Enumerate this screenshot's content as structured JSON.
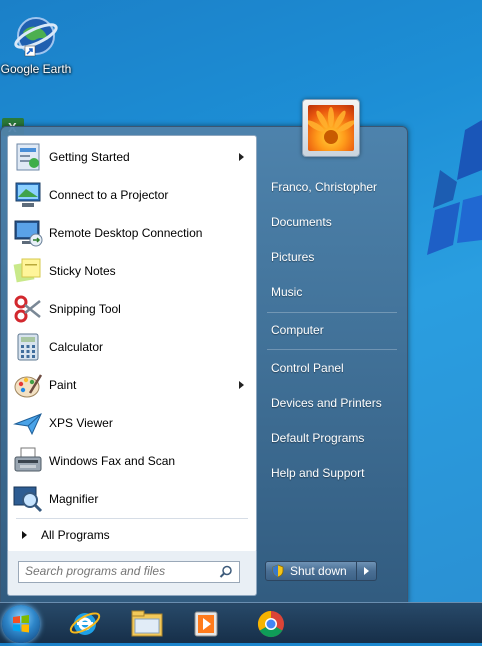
{
  "desktop": {
    "icons": [
      {
        "label": "Google Earth"
      }
    ]
  },
  "start_menu": {
    "programs": [
      {
        "label": "Getting Started",
        "icon": "getting-started-icon",
        "has_submenu": true
      },
      {
        "label": "Connect to a Projector",
        "icon": "projector-icon",
        "has_submenu": false
      },
      {
        "label": "Remote Desktop Connection",
        "icon": "remote-desktop-icon",
        "has_submenu": false
      },
      {
        "label": "Sticky Notes",
        "icon": "sticky-notes-icon",
        "has_submenu": false
      },
      {
        "label": "Snipping Tool",
        "icon": "scissors-icon",
        "has_submenu": false
      },
      {
        "label": "Calculator",
        "icon": "calculator-icon",
        "has_submenu": false
      },
      {
        "label": "Paint",
        "icon": "palette-icon",
        "has_submenu": true
      },
      {
        "label": "XPS Viewer",
        "icon": "paper-plane-icon",
        "has_submenu": false
      },
      {
        "label": "Windows Fax and Scan",
        "icon": "fax-icon",
        "has_submenu": false
      },
      {
        "label": "Magnifier",
        "icon": "magnifier-icon",
        "has_submenu": false
      }
    ],
    "all_programs_label": "All Programs",
    "search": {
      "placeholder": "Search programs and files"
    },
    "right_items": [
      {
        "label": "Franco, Christopher"
      },
      {
        "label": "Documents"
      },
      {
        "label": "Pictures"
      },
      {
        "label": "Music"
      },
      {
        "label": "Computer"
      },
      {
        "label": "Control Panel"
      },
      {
        "label": "Devices and Printers"
      },
      {
        "label": "Default Programs"
      },
      {
        "label": "Help and Support"
      }
    ],
    "shutdown_label": "Shut down"
  },
  "taskbar": {
    "pinned": [
      {
        "icon": "internet-explorer-icon"
      },
      {
        "icon": "file-explorer-icon"
      },
      {
        "icon": "media-player-icon"
      },
      {
        "icon": "chrome-icon"
      }
    ]
  },
  "colors": {
    "desktop": "#1d8fd6",
    "start_menu_right": "#4a7497",
    "taskbar": "#1c3a5a"
  }
}
